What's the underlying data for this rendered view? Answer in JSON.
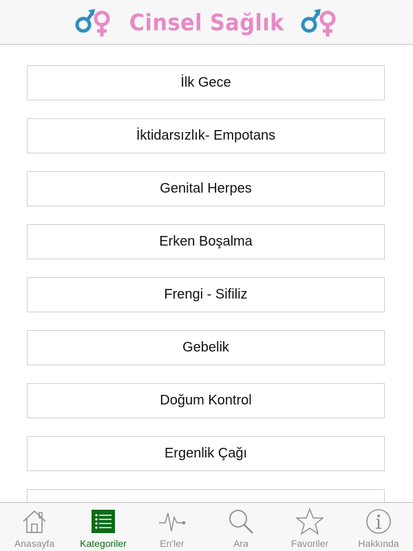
{
  "header": {
    "title": "Cinsel Sağlık"
  },
  "categories": [
    "İlk Gece",
    "İktidarsızlık- Empotans",
    "Genital Herpes",
    "Erken Boşalma",
    "Frengi - Sifiliz",
    "Gebelik",
    "Doğum Kontrol",
    "Ergenlik Çağı"
  ],
  "tabbar": {
    "active_color": "#0d6b19",
    "inactive_color": "#8e8e8e",
    "items": [
      {
        "label": "Anasayfa",
        "icon": "home-icon"
      },
      {
        "label": "Kategoriler",
        "icon": "list-icon",
        "active": true
      },
      {
        "label": "En'ler",
        "icon": "pulse-icon"
      },
      {
        "label": "Ara",
        "icon": "search-icon"
      },
      {
        "label": "Favoriler",
        "icon": "star-icon"
      },
      {
        "label": "Hakkında",
        "icon": "info-icon"
      }
    ]
  },
  "colors": {
    "brand_pink": "#e78ac6",
    "brand_blue": "#2f8fbf"
  }
}
